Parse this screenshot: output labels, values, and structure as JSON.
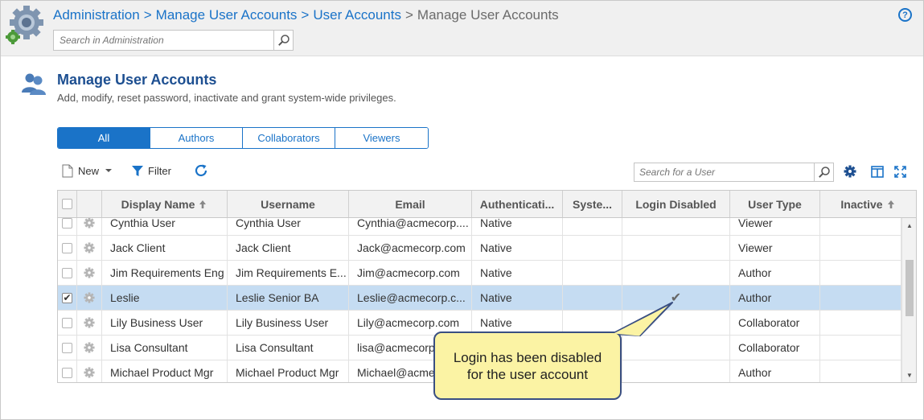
{
  "header": {
    "breadcrumb": {
      "item1": "Administration",
      "item2": "Manage User Accounts",
      "item3": "User Accounts",
      "current": "Manage User Accounts",
      "separator": ">"
    },
    "search_placeholder": "Search in Administration",
    "help_label": "?"
  },
  "page": {
    "title": "Manage User Accounts",
    "subtitle": "Add, modify, reset password, inactivate and grant system-wide privileges."
  },
  "tabs": [
    {
      "label": "All",
      "active": true
    },
    {
      "label": "Authors",
      "active": false
    },
    {
      "label": "Collaborators",
      "active": false
    },
    {
      "label": "Viewers",
      "active": false
    }
  ],
  "toolbar": {
    "new_label": "New",
    "filter_label": "Filter",
    "search_placeholder": "Search for a User"
  },
  "grid": {
    "columns": {
      "display_name": "Display Name",
      "username": "Username",
      "email": "Email",
      "authentication": "Authenticati...",
      "system": "Syste...",
      "login_disabled": "Login Disabled",
      "user_type": "User Type",
      "inactive": "Inactive"
    },
    "rows": [
      {
        "display_name": "Cynthia User",
        "username": "Cynthia User",
        "email": "Cynthia@acmecorp....",
        "auth": "Native",
        "login_disabled": "",
        "user_type": "Viewer",
        "selected": false
      },
      {
        "display_name": "Jack Client",
        "username": "Jack Client",
        "email": "Jack@acmecorp.com",
        "auth": "Native",
        "login_disabled": "",
        "user_type": "Viewer",
        "selected": false
      },
      {
        "display_name": "Jim Requirements Eng",
        "username": "Jim Requirements E...",
        "email": "Jim@acmecorp.com",
        "auth": "Native",
        "login_disabled": "",
        "user_type": "Author",
        "selected": false
      },
      {
        "display_name": "Leslie",
        "username": "Leslie Senior BA",
        "email": "Leslie@acmecorp.c...",
        "auth": "Native",
        "login_disabled": "✔",
        "user_type": "Author",
        "selected": true
      },
      {
        "display_name": "Lily Business User",
        "username": "Lily Business User",
        "email": "Lily@acmecorp.com",
        "auth": "Native",
        "login_disabled": "",
        "user_type": "Collaborator",
        "selected": false
      },
      {
        "display_name": "Lisa Consultant",
        "username": "Lisa Consultant",
        "email": "lisa@acmecorp.",
        "auth": "",
        "login_disabled": "",
        "user_type": "Collaborator",
        "selected": false
      },
      {
        "display_name": "Michael Product Mgr",
        "username": "Michael Product Mgr",
        "email": "Michael@acmec",
        "auth": "",
        "login_disabled": "",
        "user_type": "Author",
        "selected": false
      }
    ]
  },
  "callout": {
    "line1": "Login has been disabled",
    "line2": "for the user account"
  },
  "colors": {
    "accent": "#1a73c8",
    "title": "#1d4f91",
    "selected_row": "#c5dcf2",
    "callout_bg": "#fbf3a4",
    "callout_border": "#3a4f82"
  }
}
